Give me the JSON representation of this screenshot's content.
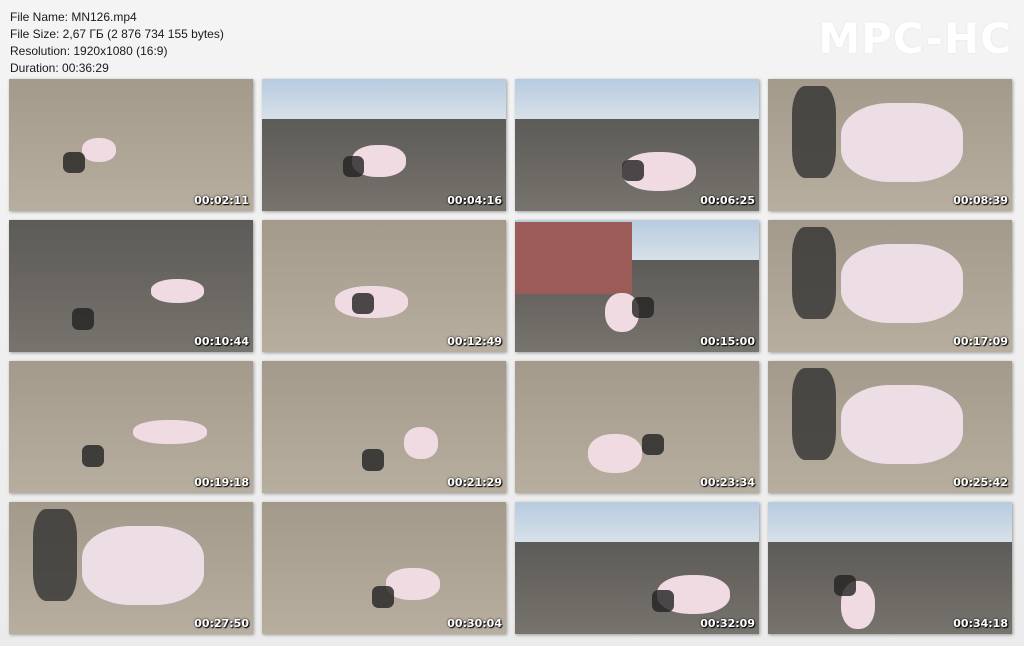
{
  "info": {
    "file_name": "File Name: MN126.mp4",
    "file_size": "File Size: 2,67 ГБ (2 876 734 155 bytes)",
    "resolution": "Resolution: 1920x1080 (16:9)",
    "duration": "Duration: 00:36:29"
  },
  "logo": "MPC-HC",
  "thumbnails": [
    {
      "time": "00:02:11",
      "scene": "sand"
    },
    {
      "time": "00:04:16",
      "scene": "sky-dark"
    },
    {
      "time": "00:06:25",
      "scene": "sky-dark"
    },
    {
      "time": "00:08:39",
      "scene": "close"
    },
    {
      "time": "00:10:44",
      "scene": "dark"
    },
    {
      "time": "00:12:49",
      "scene": "sand"
    },
    {
      "time": "00:15:00",
      "scene": "sky-building"
    },
    {
      "time": "00:17:09",
      "scene": "close"
    },
    {
      "time": "00:19:18",
      "scene": "sand"
    },
    {
      "time": "00:21:29",
      "scene": "sand"
    },
    {
      "time": "00:23:34",
      "scene": "sand"
    },
    {
      "time": "00:25:42",
      "scene": "close"
    },
    {
      "time": "00:27:50",
      "scene": "close"
    },
    {
      "time": "00:30:04",
      "scene": "sand"
    },
    {
      "time": "00:32:09",
      "scene": "sky-dark"
    },
    {
      "time": "00:34:18",
      "scene": "sky-dark"
    }
  ]
}
